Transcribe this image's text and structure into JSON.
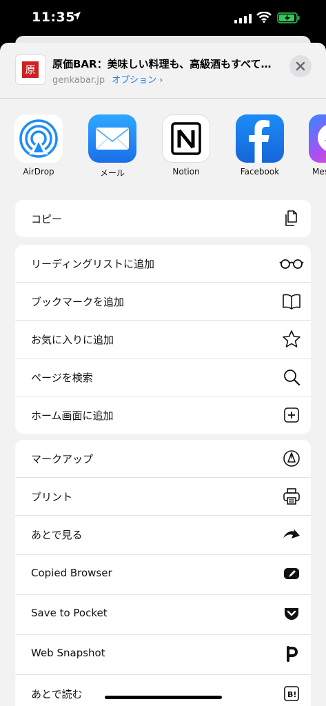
{
  "status": {
    "time": "11:35"
  },
  "header": {
    "favicon_char": "原",
    "title": "原価BAR：美味しい料理も、高級酒もすべて…",
    "url": "genkabar.jp",
    "options": "オプション ›"
  },
  "apps": [
    {
      "label": "AirDrop",
      "icon": "airdrop-icon"
    },
    {
      "label": "メール",
      "icon": "mail-icon"
    },
    {
      "label": "Notion",
      "icon": "notion-icon"
    },
    {
      "label": "Facebook",
      "icon": "facebook-icon"
    },
    {
      "label": "Mes",
      "icon": "messenger-icon"
    }
  ],
  "actions": {
    "copy": "コピー",
    "reading_list": "リーディングリストに追加",
    "bookmark": "ブックマークを追加",
    "favorites": "お気に入りに追加",
    "find": "ページを検索",
    "home_screen": "ホーム画面に追加",
    "markup": "マークアップ",
    "print": "プリント",
    "atodemiru": "あとで見る",
    "copied_browser": "Copied Browser",
    "pocket": "Save to Pocket",
    "web_snapshot": "Web Snapshot",
    "atodeyomu": "あとで読む"
  },
  "icons": {
    "copy": "copy-icon",
    "reading_list": "glasses-icon",
    "bookmark": "book-icon",
    "favorites": "star-icon",
    "find": "search-icon",
    "home_screen": "plus-square-icon",
    "markup": "markup-pen-icon",
    "print": "printer-icon",
    "atodemiru": "arrow-icon",
    "copied_browser": "compass-icon",
    "pocket": "pocket-icon",
    "web_snapshot": "p-icon",
    "atodeyomu": "hatena-b-icon"
  },
  "colors": {
    "accent": "#1a7cf5",
    "sheet_bg": "#f2f2f3",
    "battery_green": "#34c759"
  }
}
